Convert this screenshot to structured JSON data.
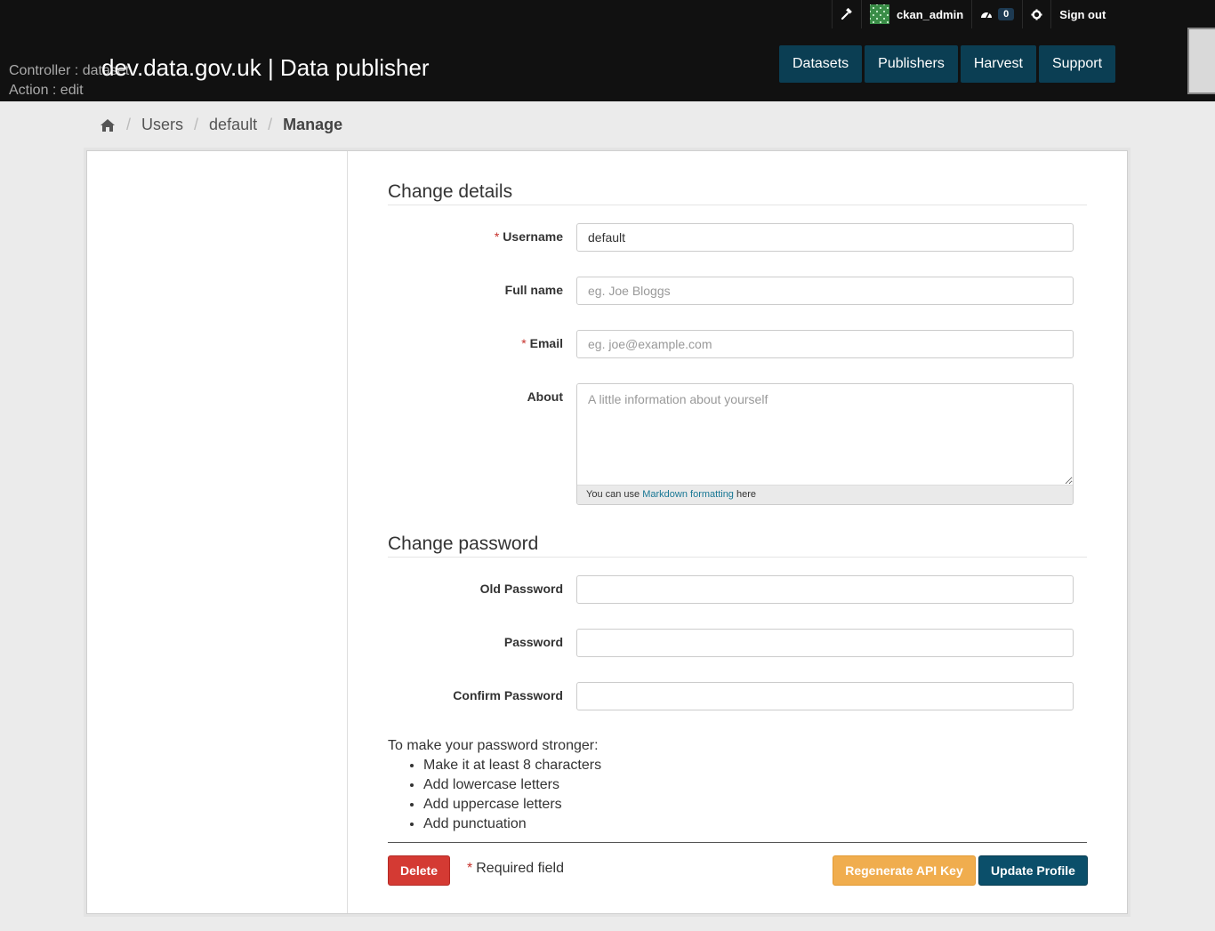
{
  "header": {
    "debug_controller": "Controller : dataset",
    "debug_action": "Action : edit",
    "site_title": "dev.data.gov.uk | Data publisher",
    "username": "ckan_admin",
    "activity_count": "0",
    "sign_out": "Sign out",
    "nav": [
      "Datasets",
      "Publishers",
      "Harvest",
      "Support"
    ],
    "icons": {
      "admin": "hammer-icon",
      "dashboard": "dashboard-icon",
      "settings": "gear-icon",
      "home": "home-icon"
    }
  },
  "breadcrumb": {
    "items": [
      "Users",
      "default",
      "Manage"
    ]
  },
  "form": {
    "change_details_title": "Change details",
    "username_label": "Username",
    "username_value": "default",
    "fullname_label": "Full name",
    "fullname_placeholder": "eg. Joe Bloggs",
    "email_label": "Email",
    "email_placeholder": "eg. joe@example.com",
    "about_label": "About",
    "about_placeholder": "A little information about yourself",
    "markdown_prefix": "You can use",
    "markdown_link": "Markdown formatting",
    "markdown_suffix": "here",
    "change_password_title": "Change password",
    "old_password_label": "Old Password",
    "password_label": "Password",
    "confirm_password_label": "Confirm Password",
    "tips_title": "To make your password stronger:",
    "tips": [
      "Make it at least 8 characters",
      "Add lowercase letters",
      "Add uppercase letters",
      "Add punctuation"
    ],
    "required_marker": "*",
    "required_note": "Required field",
    "delete_button": "Delete",
    "regenerate_button": "Regenerate API Key",
    "update_button": "Update Profile"
  },
  "colors": {
    "header_bg": "#111111",
    "nav_bg": "#0b3e53",
    "delete": "#d43a33",
    "regenerate": "#f0ad4e",
    "update": "#0b4f6a",
    "required": "#c6302a"
  }
}
